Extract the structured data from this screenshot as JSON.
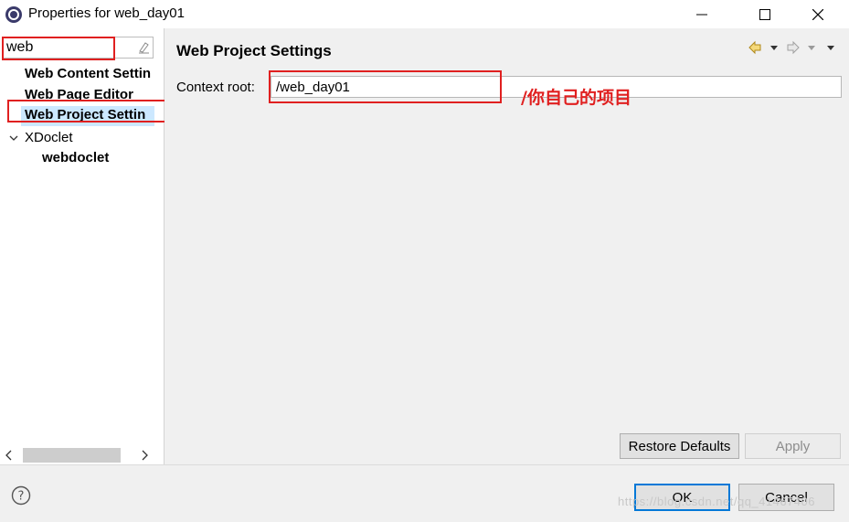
{
  "window": {
    "title": "Properties for web_day01",
    "controls": [
      "minimize",
      "maximize",
      "close"
    ]
  },
  "filter": {
    "value": "web",
    "clear_icon": "eraser-icon"
  },
  "tree": {
    "items": [
      {
        "label": "Web Content Settin"
      },
      {
        "label": "Web Page Editor"
      },
      {
        "label": "Web Project Settin",
        "selected": true
      },
      {
        "label": "XDoclet",
        "expanded": true
      },
      {
        "label": "webdoclet"
      }
    ]
  },
  "page": {
    "title": "Web Project Settings",
    "context_root_label": "Context root:",
    "context_root_value": "/web_day01",
    "annotation": "/你自己的项目"
  },
  "buttons": {
    "restore_defaults": "Restore Defaults",
    "apply": "Apply",
    "ok": "OK",
    "cancel": "Cancel"
  },
  "watermark": "https://blog.csdn.net/qq_41467406",
  "colors": {
    "highlight_red": "#e02020",
    "selection": "#cce8ff",
    "default_button_border": "#0078d7"
  }
}
